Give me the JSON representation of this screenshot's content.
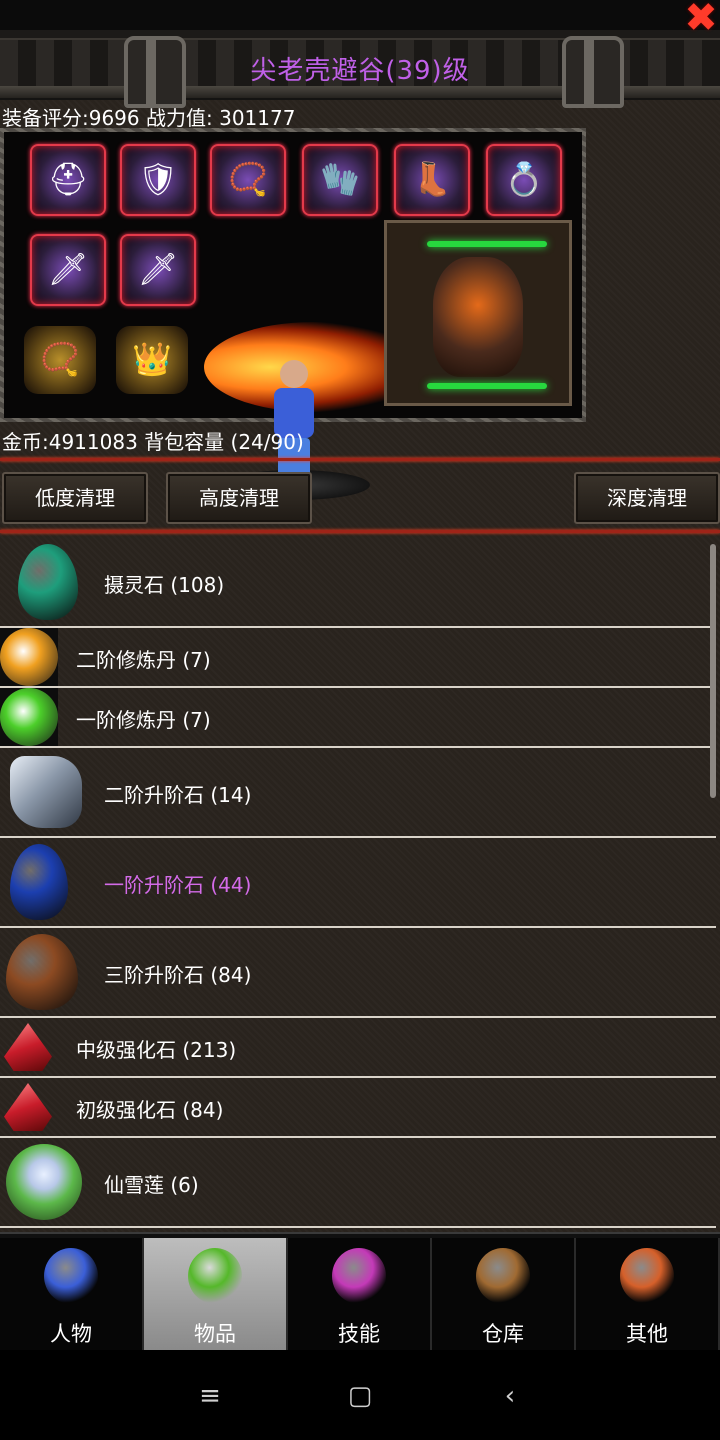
{
  "title": "尖老壳避谷(39)级",
  "close_symbol": "✖",
  "stats_line": "装备评分:9696 战力值: 301177",
  "equipment": {
    "slots": [
      {
        "name": "helmet-slot",
        "icon": "⛑"
      },
      {
        "name": "armor-slot",
        "icon": "🛡"
      },
      {
        "name": "necklace-slot",
        "icon": "📿"
      },
      {
        "name": "glove-slot",
        "icon": "🧤"
      },
      {
        "name": "boots-slot",
        "icon": "👢"
      },
      {
        "name": "ring-slot",
        "icon": "💍"
      },
      {
        "name": "weapon-slot-left",
        "icon": "🗡"
      },
      {
        "name": "weapon-slot-right",
        "icon": "🗡"
      },
      {
        "name": "bracelet-slot",
        "icon": "📿"
      },
      {
        "name": "crown-slot",
        "icon": "👑"
      }
    ]
  },
  "gold_line": "金币:4911083 背包容量 (24/90)",
  "buttons": {
    "low_clean": "低度清理",
    "high_clean": "高度清理",
    "deep_clean": "深度清理"
  },
  "items": [
    {
      "label": "摄灵石 (108)",
      "icon": "green-egg-stone-icon",
      "color": "#1e9e7c",
      "highlight": false
    },
    {
      "label": "二阶修炼丹 (7)",
      "icon": "orange-pill-icon",
      "color": "#f0a020",
      "highlight": false
    },
    {
      "label": "一阶修炼丹 (7)",
      "icon": "green-pill-icon",
      "color": "#4ccf2a",
      "highlight": false
    },
    {
      "label": "二阶升阶石 (14)",
      "icon": "gray-crystal-icon",
      "color": "#8a97a8",
      "highlight": false
    },
    {
      "label": "一阶升阶石 (44)",
      "icon": "blue-stone-icon",
      "color": "#1c3fb0",
      "highlight": true
    },
    {
      "label": "三阶升阶石 (84)",
      "icon": "brown-stone-icon",
      "color": "#8c4a22",
      "highlight": false
    },
    {
      "label": "中级强化石 (213)",
      "icon": "red-gem-icon",
      "color": "#c81c2a",
      "highlight": false
    },
    {
      "label": "初级强化石 (84)",
      "icon": "red-gem-icon",
      "color": "#c81c2a",
      "highlight": false
    },
    {
      "label": "仙雪莲 (6)",
      "icon": "lotus-flower-icon",
      "color": "#5cb84a",
      "highlight": false
    }
  ],
  "tabs": [
    {
      "label": "人物",
      "icon": "character-icon",
      "color": "#3b5fd8"
    },
    {
      "label": "物品",
      "icon": "potion-icon",
      "color": "#55b82a"
    },
    {
      "label": "技能",
      "icon": "skill-orb-icon",
      "color": "#c43ab8"
    },
    {
      "label": "仓库",
      "icon": "treasure-chest-icon",
      "color": "#a06a32"
    },
    {
      "label": "其他",
      "icon": "sword-emblem-icon",
      "color": "#d6602a"
    }
  ],
  "active_tab": "物品",
  "nav": {
    "menu": "≡",
    "home": "▢",
    "back": "‹"
  }
}
